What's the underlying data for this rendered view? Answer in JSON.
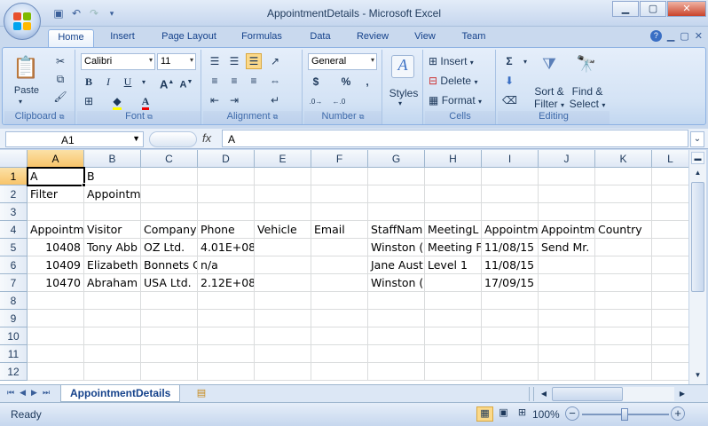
{
  "window": {
    "title": "AppointmentDetails - Microsoft Excel"
  },
  "tabs": [
    {
      "label": "Home"
    },
    {
      "label": "Insert"
    },
    {
      "label": "Page Layout"
    },
    {
      "label": "Formulas"
    },
    {
      "label": "Data"
    },
    {
      "label": "Review"
    },
    {
      "label": "View"
    },
    {
      "label": "Team"
    }
  ],
  "ribbon": {
    "clipboard": {
      "label": "Clipboard",
      "paste": "Paste"
    },
    "font": {
      "label": "Font",
      "name": "Calibri",
      "size": "11",
      "bold": "B",
      "italic": "I",
      "underline": "U"
    },
    "alignment": {
      "label": "Alignment"
    },
    "number": {
      "label": "Number",
      "format": "General",
      "currency": "$",
      "percent": "%",
      "comma": ","
    },
    "styles": {
      "label": "Styles"
    },
    "cells": {
      "label": "Cells",
      "insert": "Insert",
      "delete": "Delete",
      "format": "Format"
    },
    "editing": {
      "label": "Editing",
      "sort": "Sort &",
      "filter": "Filter",
      "find": "Find &",
      "select": "Select",
      "sum": "Σ"
    }
  },
  "formula_bar": {
    "name_box": "A1",
    "fx": "fx",
    "content": "A"
  },
  "columns": [
    "A",
    "B",
    "C",
    "D",
    "E",
    "F",
    "G",
    "H",
    "I",
    "J",
    "K",
    "L"
  ],
  "rows": [
    "1",
    "2",
    "3",
    "4",
    "5",
    "6",
    "7",
    "8",
    "9",
    "10",
    "11",
    "12"
  ],
  "cells": {
    "r1": [
      "A",
      "B"
    ],
    "r2": [
      "Filter",
      "Appointm"
    ],
    "r4": [
      "Appointm",
      "Visitor",
      "Company",
      "Phone",
      "Vehicle",
      "Email",
      "StaffNam",
      "MeetingL",
      "Appointm",
      "Appointm",
      "Country"
    ],
    "r5": [
      "10408",
      "Tony Abb",
      "OZ Ltd.",
      "4.01E+08",
      "",
      "",
      "Winston (",
      "Meeting F",
      "11/08/15",
      "Send Mr.",
      ""
    ],
    "r6": [
      "10409",
      "Elizabeth",
      "Bonnets C",
      "n/a",
      "",
      "",
      "Jane Aust",
      "Level 1",
      "11/08/15",
      "",
      ""
    ],
    "r7": [
      "10470",
      "Abraham",
      "USA Ltd.",
      "2.12E+08",
      "",
      "",
      "Winston (",
      "",
      "17/09/15",
      "",
      ""
    ]
  },
  "sheet_tab": "AppointmentDetails",
  "status": {
    "text": "Ready",
    "zoom": "100%"
  }
}
